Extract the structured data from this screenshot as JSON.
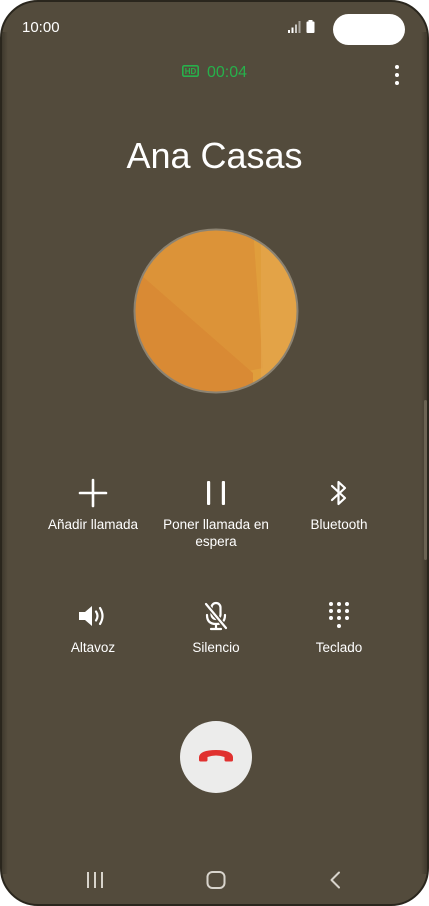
{
  "status_bar": {
    "time": "10:00",
    "icons": [
      "signal-icon",
      "battery-icon"
    ]
  },
  "call": {
    "hd_badge": "HD",
    "duration": "00:04",
    "caller_name": "Ana Casas",
    "status_color": "#27b04b"
  },
  "actions": [
    {
      "label": "Añadir llamada",
      "icon": "plus-icon"
    },
    {
      "label": "Poner llamada en espera",
      "icon": "pause-icon"
    },
    {
      "label": "Bluetooth",
      "icon": "bluetooth-icon"
    },
    {
      "label": "Altavoz",
      "icon": "speaker-icon"
    },
    {
      "label": "Silencio",
      "icon": "mic-off-icon"
    },
    {
      "label": "Teclado",
      "icon": "keypad-icon"
    }
  ],
  "end_call": {
    "icon": "end-call-icon",
    "color": "#e0312f"
  },
  "nav": [
    "recent-apps-icon",
    "home-icon",
    "back-icon"
  ],
  "colors": {
    "background": "#534b3c",
    "avatar": "#e09e3c"
  }
}
